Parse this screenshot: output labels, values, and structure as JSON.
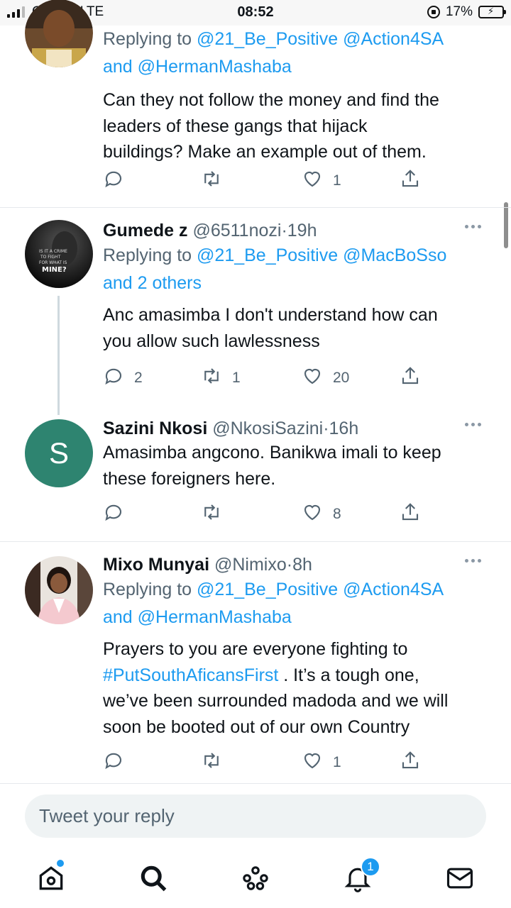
{
  "status_bar": {
    "carrier": "Cell C",
    "network": "LTE",
    "time": "08:52",
    "battery": "17%",
    "battery_level": 0.17
  },
  "tweets": [
    {
      "name": "",
      "handle": "",
      "ago": "",
      "replying_prefix": "Replying to",
      "replying_line1": "@21_Be_Positive @Action4SA",
      "replying_line2_link": "and @HermanMashaba",
      "text": [
        "Can they not follow the money and find the",
        "leaders of these gangs that hijack",
        "buildings? Make an example out of them."
      ],
      "replies": "",
      "retweets": "",
      "likes": "1"
    },
    {
      "name": "Gumede z",
      "handle": "@6511nozi",
      "ago": "19h",
      "replying_prefix": "Replying to",
      "replying_line1": "@21_Be_Positive @MacBoSso",
      "replying_line2_link": "and 2 others",
      "avatar_text": [
        "IS IT A CRIME",
        "TO FIGHT",
        "FOR WHAT IS",
        "MINE?"
      ],
      "text": [
        "Anc amasimba I don't understand how can",
        "you allow such lawlessness"
      ],
      "replies": "2",
      "retweets": "1",
      "likes": "20"
    },
    {
      "name": "Sazini Nkosi",
      "handle": "@NkosiSazini",
      "ago": "16h",
      "avatar_letter": "S",
      "avatar_color": "#2e8470",
      "text": [
        "Amasimba angcono. Banikwa imali to keep",
        "these foreigners here."
      ],
      "replies": "",
      "retweets": "",
      "likes": "8"
    },
    {
      "name": "Mixo Munyai",
      "handle": "@Nimixo",
      "ago": "8h",
      "replying_prefix": "Replying to",
      "replying_line1": "@21_Be_Positive @Action4SA",
      "replying_line2_link": "and @HermanMashaba",
      "hashtag": "#PutSouthAficansFirst",
      "text_line1": "Prayers to you are everyone fighting to",
      "text_after_hashtag": " . It’s a tough one,",
      "text_rest": [
        "we’ve been surrounded madoda and we will",
        "soon be booted out of our own Country"
      ],
      "replies": "",
      "retweets": "",
      "likes": "1"
    }
  ],
  "reply_placeholder": "Tweet your reply",
  "nav": {
    "notifications_badge": "1"
  },
  "colors": {
    "link": "#1d9bf0",
    "muted": "#536471",
    "divider": "#e6e9ec"
  },
  "icons": [
    "reply-icon",
    "retweet-icon",
    "like-icon",
    "share-icon",
    "home-icon",
    "search-icon",
    "spaces-icon",
    "notifications-icon",
    "messages-icon"
  ]
}
